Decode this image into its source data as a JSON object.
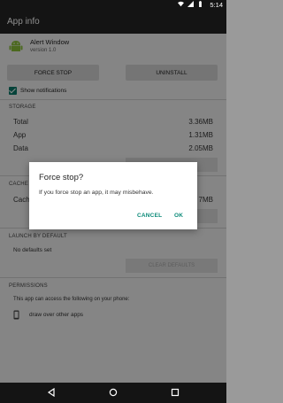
{
  "status_bar": {
    "time": "5:14",
    "icons": [
      "wifi-icon",
      "signal-icon",
      "battery-icon"
    ]
  },
  "app_bar": {
    "title": "App info"
  },
  "app": {
    "name": "Alert Window",
    "version": "version 1.0",
    "icon": "android-icon"
  },
  "buttons": {
    "force_stop": "FORCE STOP",
    "uninstall": "UNINSTALL"
  },
  "notifications": {
    "label": "Show notifications",
    "checked": true
  },
  "storage": {
    "title": "STORAGE",
    "rows": [
      {
        "label": "Total",
        "value": "3.36MB"
      },
      {
        "label": "App",
        "value": "1.31MB"
      },
      {
        "label": "Data",
        "value": "2.05MB"
      }
    ]
  },
  "cache": {
    "title": "CACHE",
    "label": "Cache",
    "value": "7MB"
  },
  "launch": {
    "title": "LAUNCH BY DEFAULT",
    "text": "No defaults set",
    "clear_label": "CLEAR DEFAULTS"
  },
  "permissions": {
    "title": "PERMISSIONS",
    "text": "This app can access the following on your phone:",
    "item": "draw over other apps"
  },
  "dialog": {
    "title": "Force stop?",
    "message": "If you force stop an app, it may misbehave.",
    "cancel_label": "CANCEL",
    "ok_label": "OK"
  },
  "colors": {
    "accent": "#0b8a78",
    "checkbox": "#0b7a6b",
    "appbar": "#262626",
    "statusbar": "#141414"
  }
}
